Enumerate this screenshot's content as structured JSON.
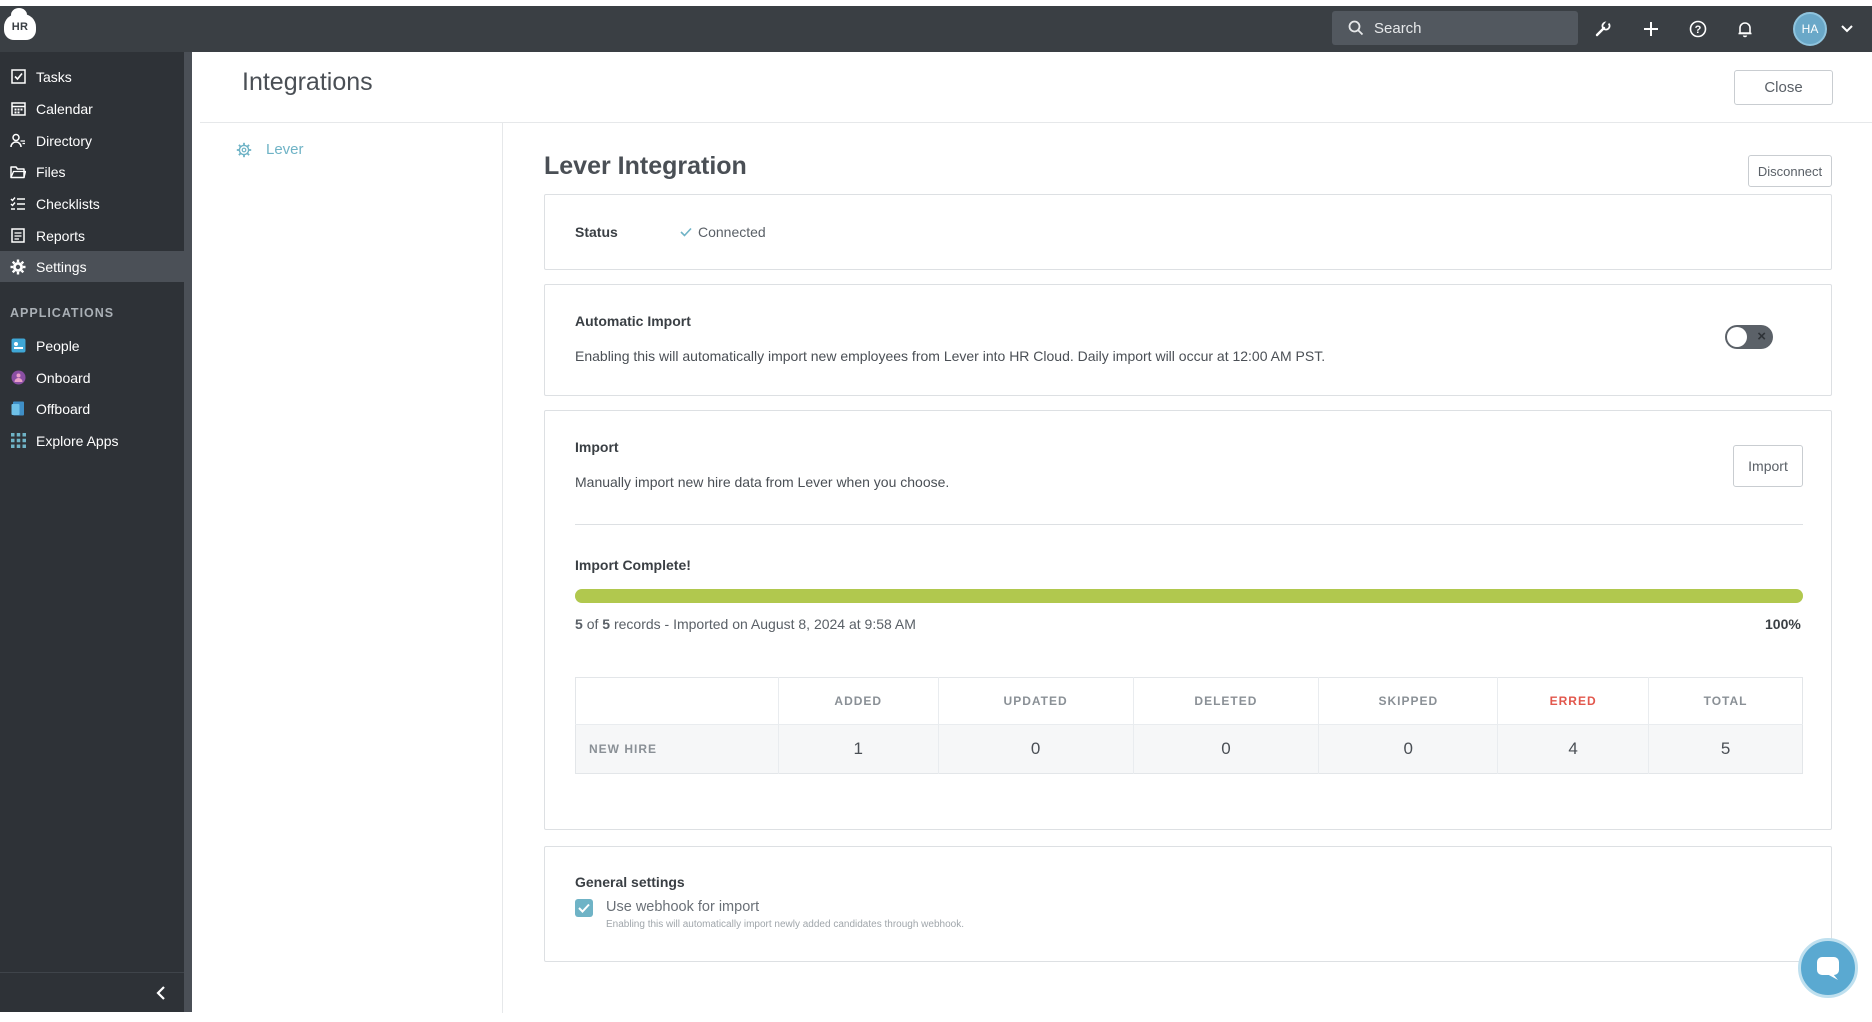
{
  "topbar": {
    "logo_text": "HR",
    "search_placeholder": "Search",
    "avatar_initials": "HA",
    "icons": [
      "wrench-icon",
      "plus-icon",
      "help-icon",
      "bell-icon",
      "chevron-down-icon"
    ]
  },
  "sidebar": {
    "items": [
      {
        "label": "Tasks",
        "icon": "checkbox-icon"
      },
      {
        "label": "Calendar",
        "icon": "calendar-icon"
      },
      {
        "label": "Directory",
        "icon": "people-icon"
      },
      {
        "label": "Files",
        "icon": "folder-icon"
      },
      {
        "label": "Checklists",
        "icon": "checklist-icon"
      },
      {
        "label": "Reports",
        "icon": "report-icon"
      },
      {
        "label": "Settings",
        "icon": "gear-icon",
        "active": true
      }
    ],
    "applications_header": "APPLICATIONS",
    "apps": [
      {
        "label": "People",
        "icon": "people-app-icon",
        "color": "#3fa7d6"
      },
      {
        "label": "Onboard",
        "icon": "onboard-app-icon",
        "color": "#8a4fa3"
      },
      {
        "label": "Offboard",
        "icon": "offboard-app-icon",
        "color": "#3f8fc7"
      },
      {
        "label": "Explore Apps",
        "icon": "grid-icon",
        "color": "#6fb3c6"
      }
    ]
  },
  "header": {
    "title": "Integrations",
    "close_label": "Close"
  },
  "subnav": {
    "items": [
      {
        "label": "Lever",
        "icon": "gear-icon"
      }
    ]
  },
  "main": {
    "title": "Lever Integration",
    "disconnect_label": "Disconnect",
    "status": {
      "label": "Status",
      "value": "Connected"
    },
    "auto_import": {
      "label": "Automatic Import",
      "description": "Enabling this will automatically import new employees from Lever into HR Cloud. Daily import will occur at 12:00 AM PST.",
      "enabled": false
    },
    "import": {
      "label": "Import",
      "description": "Manually import new hire data from Lever when you choose.",
      "button_label": "Import",
      "complete_label": "Import Complete!",
      "progress": 1.0,
      "progress_text": "100%",
      "records_done": "5",
      "records_of": "of",
      "records_total": "5",
      "records_suffix": "records - Imported on August 8, 2024 at 9:58 AM",
      "table": {
        "columns": [
          "",
          "ADDED",
          "UPDATED",
          "DELETED",
          "SKIPPED",
          "ERRED",
          "TOTAL"
        ],
        "rows": [
          {
            "label": "NEW HIRE",
            "values": [
              "1",
              "0",
              "0",
              "0",
              "4",
              "5"
            ]
          }
        ]
      }
    },
    "general_settings": {
      "label": "General settings",
      "webhook_label": "Use webhook for import",
      "webhook_checked": true,
      "webhook_help": "Enabling this will automatically import newly added candidates through webhook."
    }
  },
  "colors": {
    "accent": "#6fb3c6",
    "progress": "#b1c84e",
    "erred": "#e2574c",
    "sidebar_bg": "#2e3237",
    "topbar_bg": "#3a3f44"
  }
}
